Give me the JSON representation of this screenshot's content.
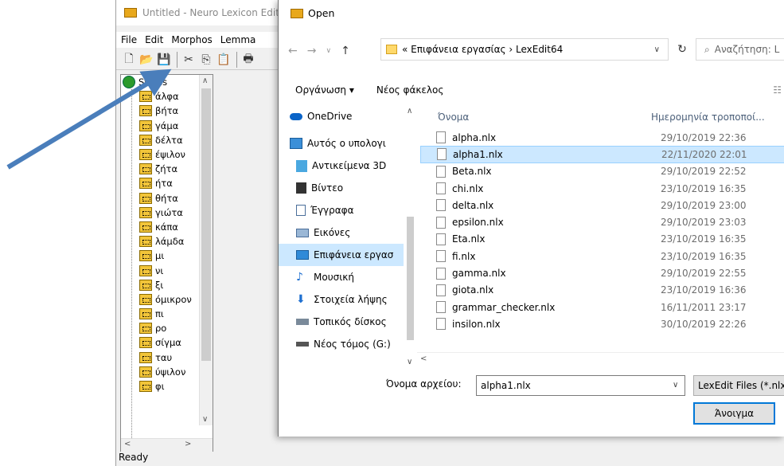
{
  "app": {
    "title": "Untitled - Neuro Lexicon Edit",
    "menu": [
      "File",
      "Edit",
      "Morphos",
      "Lemma"
    ],
    "status": "Ready"
  },
  "tree": {
    "root": "Stems",
    "items": [
      "άλφα",
      "βήτα",
      "γάμα",
      "δέλτα",
      "έψιλον",
      "ζήτα",
      "ήτα",
      "θήτα",
      "γιώτα",
      "κάπα",
      "λάμδα",
      "μι",
      "νι",
      "ξι",
      "όμικρον",
      "πι",
      "ρο",
      "σίγμα",
      "ταυ",
      "ύψιλον",
      "φι"
    ]
  },
  "dialog": {
    "title": "Open",
    "breadcrumb": "«  Επιφάνεια εργασίας  ›  LexEdit64",
    "search_placeholder": "Αναζήτηση: L",
    "organize": "Οργάνωση ▾",
    "new_folder": "Νέος φάκελος",
    "nav_items": [
      {
        "label": "OneDrive",
        "icon": "cloud-icon"
      },
      {
        "label": "Αυτός ο υπολογι",
        "icon": "computer-icon"
      },
      {
        "label": "Αντικείμενα 3D",
        "icon": "cube-icon"
      },
      {
        "label": "Βίντεο",
        "icon": "video-icon"
      },
      {
        "label": "Έγγραφα",
        "icon": "document-icon"
      },
      {
        "label": "Εικόνες",
        "icon": "picture-icon"
      },
      {
        "label": "Επιφάνεια εργασ",
        "icon": "desktop-icon"
      },
      {
        "label": "Μουσική",
        "icon": "music-icon"
      },
      {
        "label": "Στοιχεία λήψης",
        "icon": "download-icon"
      },
      {
        "label": "Τοπικός δίσκος",
        "icon": "drive-icon"
      },
      {
        "label": "Νέος τόμος (G:)",
        "icon": "drive-icon"
      }
    ],
    "col_name": "Όνομα",
    "col_date": "Ημερομηνία τροποποί...",
    "files": [
      {
        "name": "alpha.nlx",
        "date": "29/10/2019 22:36"
      },
      {
        "name": "alpha1.nlx",
        "date": "22/11/2020 22:01"
      },
      {
        "name": "Beta.nlx",
        "date": "29/10/2019 22:52"
      },
      {
        "name": "chi.nlx",
        "date": "23/10/2019 16:35"
      },
      {
        "name": "delta.nlx",
        "date": "29/10/2019 23:00"
      },
      {
        "name": "epsilon.nlx",
        "date": "29/10/2019 23:03"
      },
      {
        "name": "Eta.nlx",
        "date": "23/10/2019 16:35"
      },
      {
        "name": "fi.nlx",
        "date": "23/10/2019 16:35"
      },
      {
        "name": "gamma.nlx",
        "date": "29/10/2019 22:55"
      },
      {
        "name": "giota.nlx",
        "date": "23/10/2019 16:36"
      },
      {
        "name": "grammar_checker.nlx",
        "date": "16/11/2011 23:17"
      },
      {
        "name": "insilon.nlx",
        "date": "30/10/2019 22:26"
      }
    ],
    "filename_label": "Όνομα αρχείου:",
    "filename_value": "alpha1.nlx",
    "filter": "LexEdit Files (*.nlx)",
    "open_button": "Άνοιγμα"
  }
}
